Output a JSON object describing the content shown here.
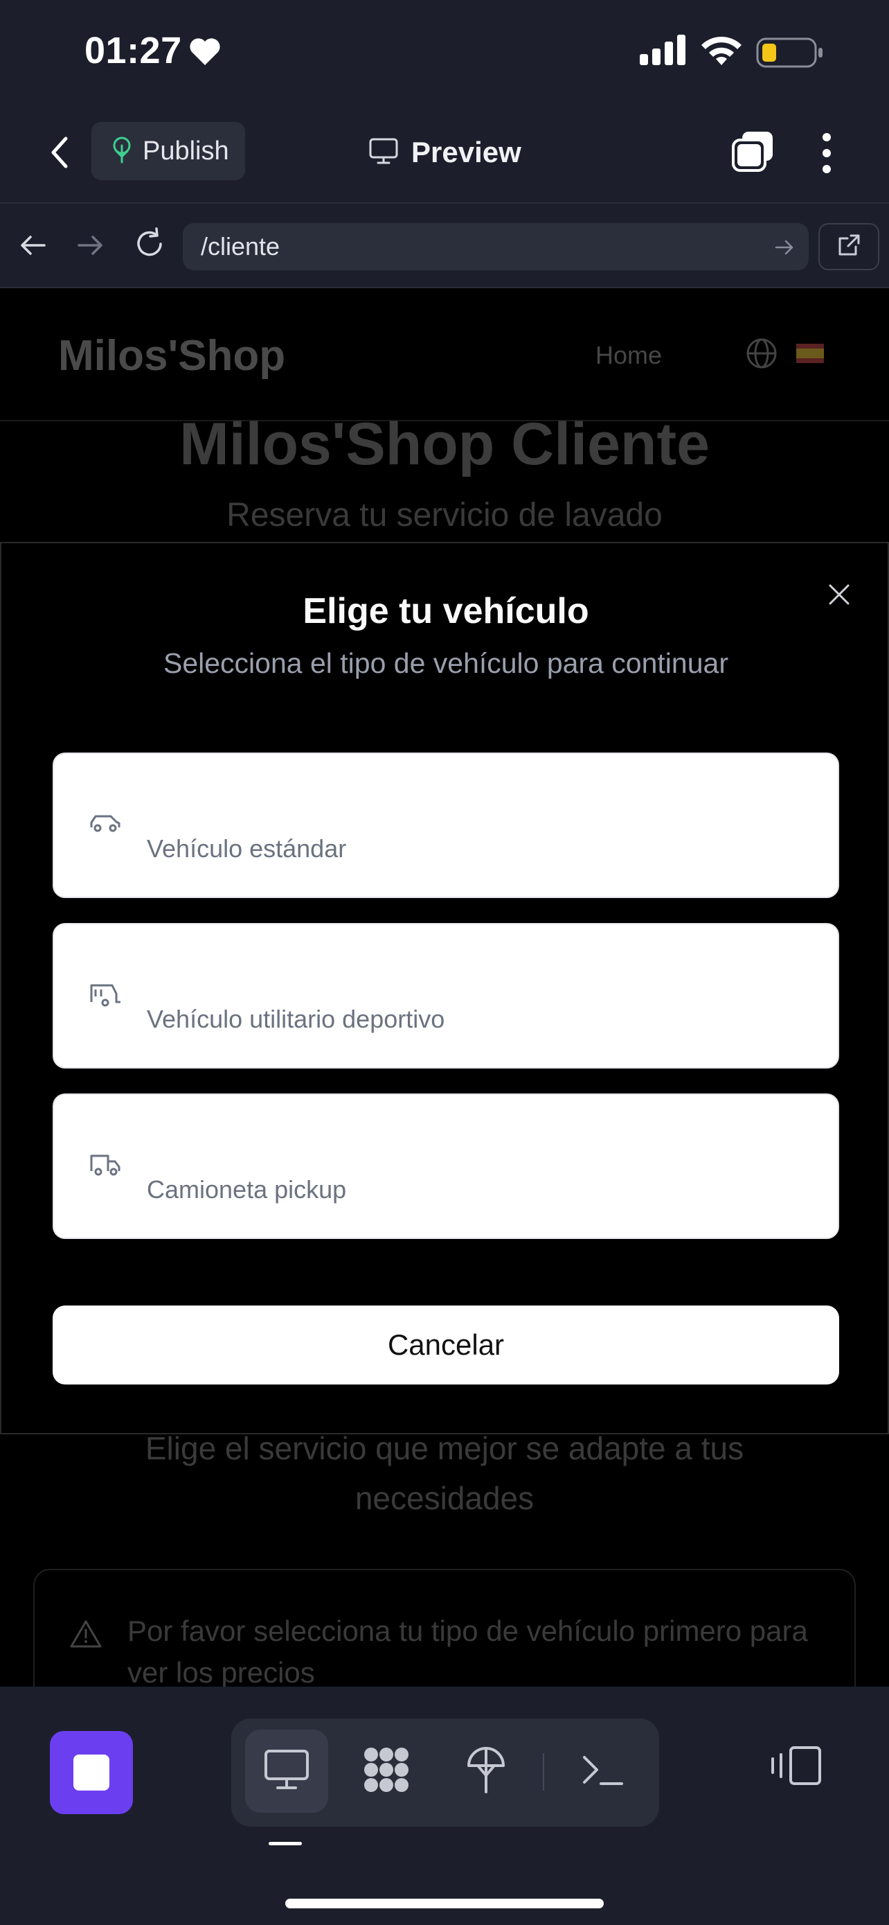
{
  "status_bar": {
    "time": "01:27"
  },
  "toolbar": {
    "publish_label": "Publish",
    "preview_label": "Preview"
  },
  "browser": {
    "url": "/cliente"
  },
  "site": {
    "logo": "Milos'Shop",
    "nav_home": "Home",
    "heading": "Milos'Shop Cliente",
    "subheading": "Reserva tu servicio de lavado",
    "services_text": "Elige el servicio que mejor se adapte a tus necesidades",
    "warning_text": "Por favor selecciona tu tipo de vehículo primero para ver los precios"
  },
  "modal": {
    "title": "Elige tu vehículo",
    "subtitle": "Selecciona el tipo de vehículo para continuar",
    "options": [
      {
        "label": "Vehículo estándar",
        "icon": "car-icon"
      },
      {
        "label": "Vehículo utilitario deportivo",
        "icon": "caravan-icon"
      },
      {
        "label": "Camioneta pickup",
        "icon": "truck-icon"
      }
    ],
    "cancel_label": "Cancelar"
  },
  "colors": {
    "accent": "#6b3ef0",
    "publish_icon": "#3ecf8e",
    "battery_fill": "#f5c518"
  }
}
